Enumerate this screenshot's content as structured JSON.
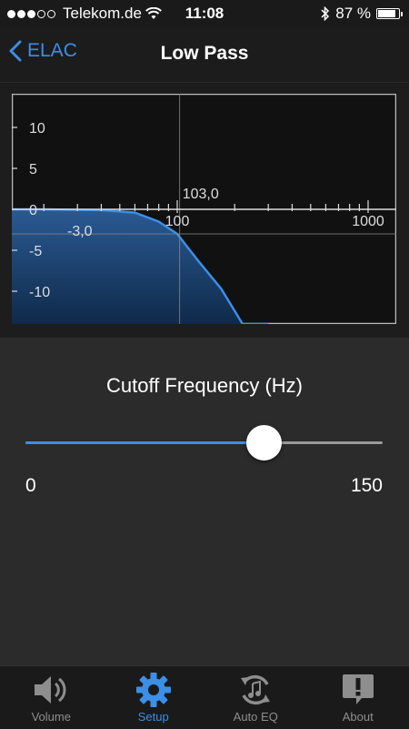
{
  "status_bar": {
    "carrier": "Telekom.de",
    "time": "11:08",
    "battery": "87 %",
    "battery_level": 0.87,
    "signal_bars_filled": 3,
    "signal_bars_total": 5
  },
  "nav": {
    "back_label": "ELAC",
    "title": "Low Pass"
  },
  "chart": {
    "y_ticks": [
      "10",
      "5",
      "0",
      "-5",
      "-10"
    ],
    "x_ticks": [
      "100",
      "1000"
    ],
    "cursor_freq_label": "103,0",
    "cursor_gain_label": "-3,0",
    "accent_color": "#3b8fe6"
  },
  "chart_data": {
    "type": "area",
    "x_scale": "log",
    "xlim": [
      10,
      1300
    ],
    "ylim": [
      -14,
      14
    ],
    "x": [
      10,
      20,
      40,
      60,
      80,
      100,
      130,
      170,
      220,
      300
    ],
    "y": [
      0,
      0,
      -0.1,
      -0.4,
      -1.5,
      -3.0,
      -6.4,
      -9.7,
      -14,
      -14
    ],
    "cursor": {
      "x": 103.0,
      "y": -3.0
    }
  },
  "control": {
    "label": "Cutoff Frequency (Hz)",
    "min_label": "0",
    "max_label": "150",
    "value_fraction": 0.667
  },
  "tabs": [
    {
      "label": "Volume",
      "icon": "speaker-icon",
      "active": false
    },
    {
      "label": "Setup",
      "icon": "gear-icon",
      "active": true
    },
    {
      "label": "Auto EQ",
      "icon": "auto-eq-icon",
      "active": false
    },
    {
      "label": "About",
      "icon": "info-bubble-icon",
      "active": false
    }
  ]
}
